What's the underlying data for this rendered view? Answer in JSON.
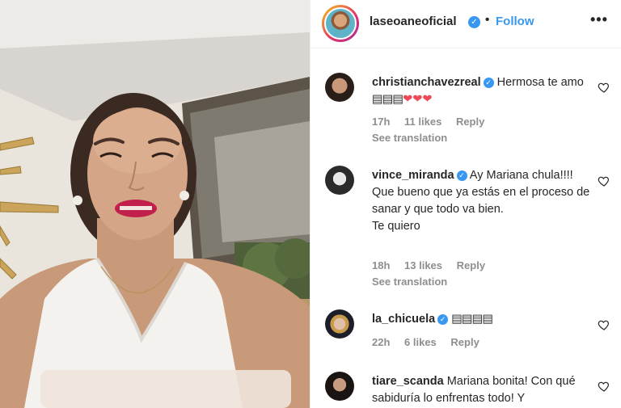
{
  "post": {
    "username": "laseoaneoficial",
    "follow_label": "Follow",
    "separator": "•",
    "more_label": "•••"
  },
  "comments": [
    {
      "username": "christianchavezreal",
      "text": "Hermosa te amo",
      "emoji": "▤▤▤",
      "hearts": "❤❤❤",
      "time": "17h",
      "likes": "11 likes",
      "reply": "Reply",
      "translation": "See translation"
    },
    {
      "username": "vince_miranda",
      "text": "Ay Mariana chula!!!! Que bueno que ya estás en el proceso de sanar y que todo va bien.",
      "text2": "Te quiero",
      "time": "18h",
      "likes": "13 likes",
      "reply": "Reply",
      "translation": "See translation"
    },
    {
      "username": "la_chicuela",
      "emoji": "▤▤▤▤",
      "time": "22h",
      "likes": "6 likes",
      "reply": "Reply"
    },
    {
      "username": "tiare_scanda",
      "text": "Mariana bonita! Con qué sabiduría lo enfrentas todo! Y"
    }
  ],
  "icons": {
    "verified": "verified-badge-icon",
    "heart": "heart-outline-icon",
    "more": "more-options-icon"
  },
  "colors": {
    "link_blue": "#3897f0",
    "text": "#262626",
    "muted": "#8e8e8e",
    "heart_red": "#ed4956",
    "lipstick": "#c0204a"
  }
}
